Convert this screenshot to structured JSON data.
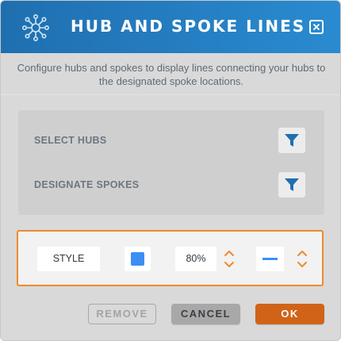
{
  "header": {
    "title": "HUB AND SPOKE LINES",
    "logo_icon": "hub-spoke-icon",
    "close_icon": "close-icon"
  },
  "description": "Configure hubs and spokes to display lines connecting your hubs to the designated spoke locations.",
  "config": {
    "hubs": {
      "label": "SELECT HUBS",
      "icon": "filter-icon"
    },
    "spokes": {
      "label": "DESIGNATE SPOKES",
      "icon": "filter-icon"
    }
  },
  "style": {
    "label": "STYLE",
    "line_color": "#3d8ef4",
    "opacity": "80%",
    "line_style": "solid",
    "stepper_icon": "up-down-arrows-icon"
  },
  "buttons": {
    "remove": "REMOVE",
    "cancel": "CANCEL",
    "ok": "OK"
  },
  "colors": {
    "header": "#2a8bd0",
    "accent": "#ef8a2c",
    "ok_button": "#d16319",
    "filter_icon": "#1f6fb0"
  }
}
